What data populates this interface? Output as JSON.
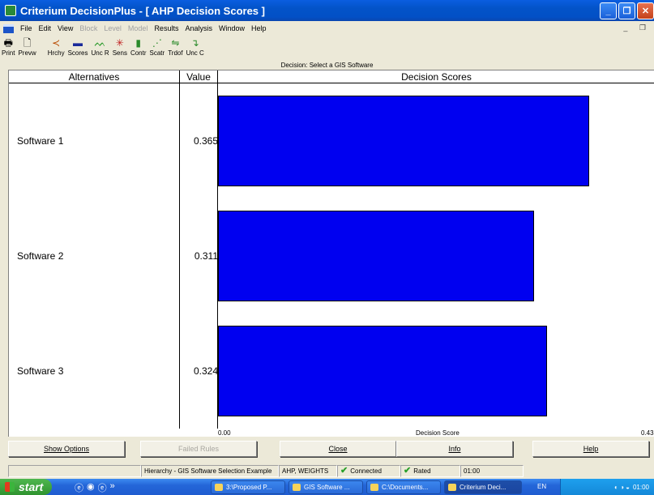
{
  "window": {
    "title": "Criterium DecisionPlus - [ AHP Decision Scores ]"
  },
  "menu": {
    "items": [
      {
        "label": "File",
        "enabled": true
      },
      {
        "label": "Edit",
        "enabled": true
      },
      {
        "label": "View",
        "enabled": true
      },
      {
        "label": "Block",
        "enabled": false
      },
      {
        "label": "Level",
        "enabled": false
      },
      {
        "label": "Model",
        "enabled": false
      },
      {
        "label": "Results",
        "enabled": true
      },
      {
        "label": "Analysis",
        "enabled": true
      },
      {
        "label": "Window",
        "enabled": true
      },
      {
        "label": "Help",
        "enabled": true
      }
    ]
  },
  "toolbar": {
    "print": "Print",
    "preview": "Prevw",
    "hierarchy": "Hrchy",
    "scores": "Scores",
    "unc_r": "Unc R",
    "sens": "Sens",
    "contr": "Contr",
    "scatr": "Scatr",
    "trdof": "Trdof",
    "unc_c": "Unc C"
  },
  "decision": {
    "label": "Decision: Select a GIS Software"
  },
  "table": {
    "col_alternatives": "Alternatives",
    "col_value": "Value",
    "col_scores": "Decision Scores"
  },
  "chart_data": {
    "type": "bar",
    "orientation": "horizontal",
    "categories": [
      "Software 1",
      "Software 2",
      "Software 3"
    ],
    "values": [
      0.365,
      0.311,
      0.324
    ],
    "value_labels": [
      "0.365",
      "0.311",
      "0.324"
    ],
    "xlabel": "Decision Score",
    "xlim": [
      0,
      0.43
    ],
    "x_tick_start": "0.00",
    "x_tick_end": "0.43",
    "bar_color": "#0000f0"
  },
  "buttons": {
    "show_options": "Show Options",
    "failed_rules": "Failed Rules",
    "close": "Close",
    "info": "Info",
    "help": "Help"
  },
  "status": {
    "hierarchy": "Hierarchy - GIS Software Selection Example",
    "method": "AHP, WEIGHTS",
    "connected": "Connected",
    "rated": "Rated",
    "time": "01:00"
  },
  "taskbar": {
    "start": "start",
    "tasks": [
      "3:\\Proposed P...",
      "GIS Software ...",
      "C:\\Documents...",
      "Criterium Deci..."
    ],
    "lang": "EN",
    "clock": "01:00"
  }
}
